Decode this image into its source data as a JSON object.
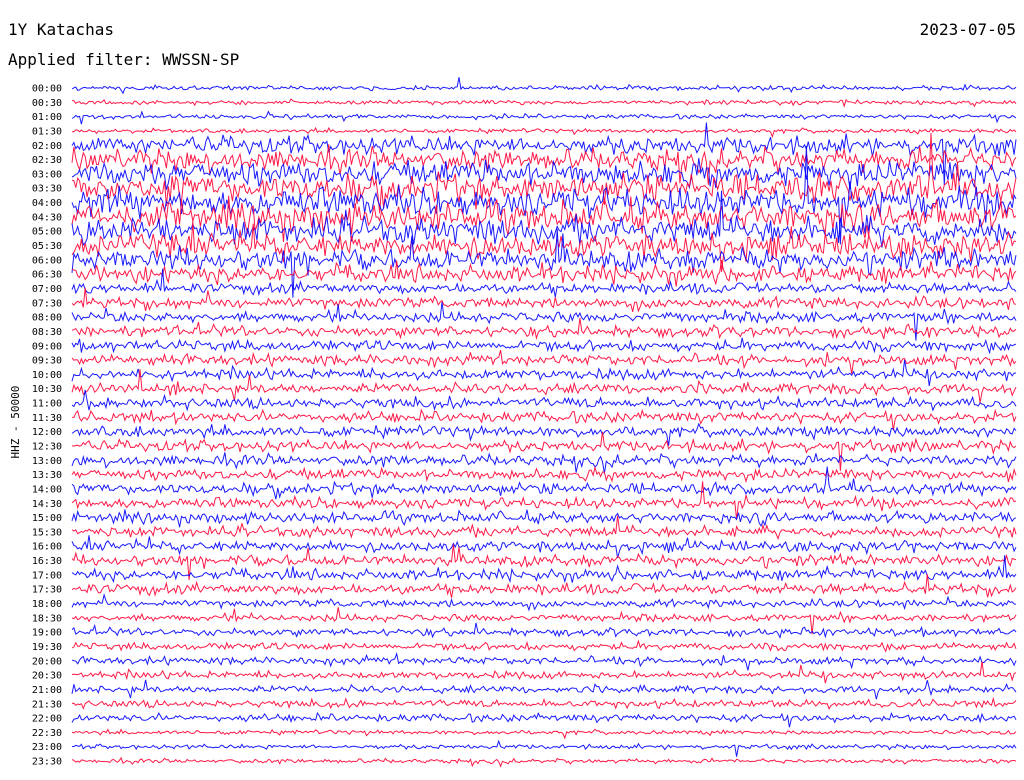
{
  "header": {
    "station": "1Y Katachas",
    "date": "2023-07-05",
    "filter_label": "Applied filter:",
    "filter_value": "WWSSN-SP"
  },
  "chart_data": {
    "type": "line",
    "subtype": "helicorder",
    "ylabel": "HHZ - 50000",
    "time_labels": [
      "00:00",
      "00:30",
      "01:00",
      "01:30",
      "02:00",
      "02:30",
      "03:00",
      "03:30",
      "04:00",
      "04:30",
      "05:00",
      "05:30",
      "06:00",
      "06:30",
      "07:00",
      "07:30",
      "08:00",
      "08:30",
      "09:00",
      "09:30",
      "10:00",
      "10:30",
      "11:00",
      "11:30",
      "12:00",
      "12:30",
      "13:00",
      "13:30",
      "14:00",
      "14:30",
      "15:00",
      "15:30",
      "16:00",
      "16:30",
      "17:00",
      "17:30",
      "18:00",
      "18:30",
      "19:00",
      "19:30",
      "20:00",
      "20:30",
      "21:00",
      "21:30",
      "22:00",
      "22:30",
      "23:00",
      "23:30"
    ],
    "trace_colors": [
      "#0000ff",
      "#ff0033"
    ],
    "grid": false
  }
}
